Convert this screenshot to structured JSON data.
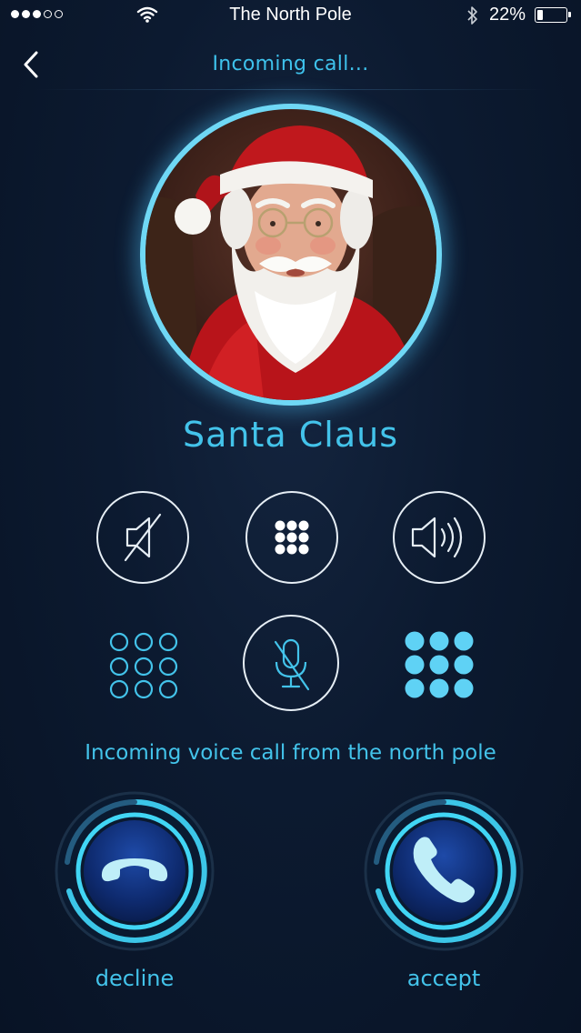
{
  "status_bar": {
    "carrier": "The North Pole",
    "battery_percent": "22%",
    "battery_level": 0.22,
    "signal_bars_filled": 3,
    "signal_bars_total": 5
  },
  "nav": {
    "title": "Incoming call...",
    "back_icon": "chevron-left-icon"
  },
  "caller": {
    "name": "Santa Claus",
    "avatar": "santa-claus-photo"
  },
  "controls": {
    "row1": [
      "mute-speaker-icon",
      "keypad-icon",
      "speaker-icon"
    ],
    "row2": [
      "keypad-outline-icon",
      "mute-mic-icon",
      "keypad-filled-icon"
    ]
  },
  "message": "Incoming voice call from the north pole",
  "actions": {
    "decline_label": "decline",
    "accept_label": "accept"
  },
  "colors": {
    "accent": "#43c3ea",
    "background": "#0c1a30",
    "ring": "#6fd8f5"
  }
}
